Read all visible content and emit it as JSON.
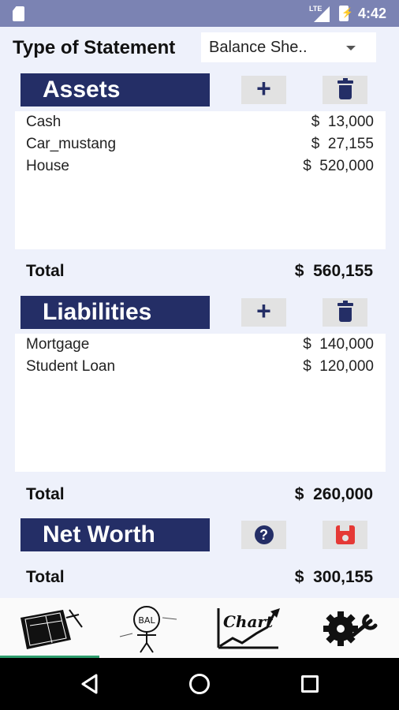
{
  "status_bar": {
    "network": "LTE",
    "time": "4:42",
    "icons": [
      "sim-icon",
      "signal-icon",
      "battery-charging-icon"
    ]
  },
  "statement": {
    "label": "Type of Statement",
    "selected": "Balance She.."
  },
  "assets": {
    "title": "Assets",
    "items": [
      {
        "name": "Cash",
        "amount": "$  13,000"
      },
      {
        "name": "Car_mustang",
        "amount": "$  27,155"
      },
      {
        "name": "House",
        "amount": "$  520,000"
      }
    ],
    "total_label": "Total",
    "total_amount": "$  560,155"
  },
  "liabilities": {
    "title": "Liabilities",
    "items": [
      {
        "name": "Mortgage",
        "amount": "$  140,000"
      },
      {
        "name": "Student Loan",
        "amount": "$  120,000"
      }
    ],
    "total_label": "Total",
    "total_amount": "$  260,000"
  },
  "net_worth": {
    "title": "Net Worth",
    "total_label": "Total",
    "total_amount": "$  300,155"
  },
  "tabs": {
    "active": 0,
    "items": [
      {
        "icon": "balance-book-icon",
        "label": "Asset Liability Book"
      },
      {
        "icon": "balance-sheet-icon",
        "label": "BAL"
      },
      {
        "icon": "chart-icon",
        "label": "Chart"
      },
      {
        "icon": "settings-gears-icon",
        "label": ""
      }
    ]
  },
  "colors": {
    "header_bg": "#242e66",
    "status_bar": "#7b83b3",
    "page_bg": "#eef1fb",
    "save": "#e53935",
    "tab_indicator": "#2e9e6e"
  }
}
